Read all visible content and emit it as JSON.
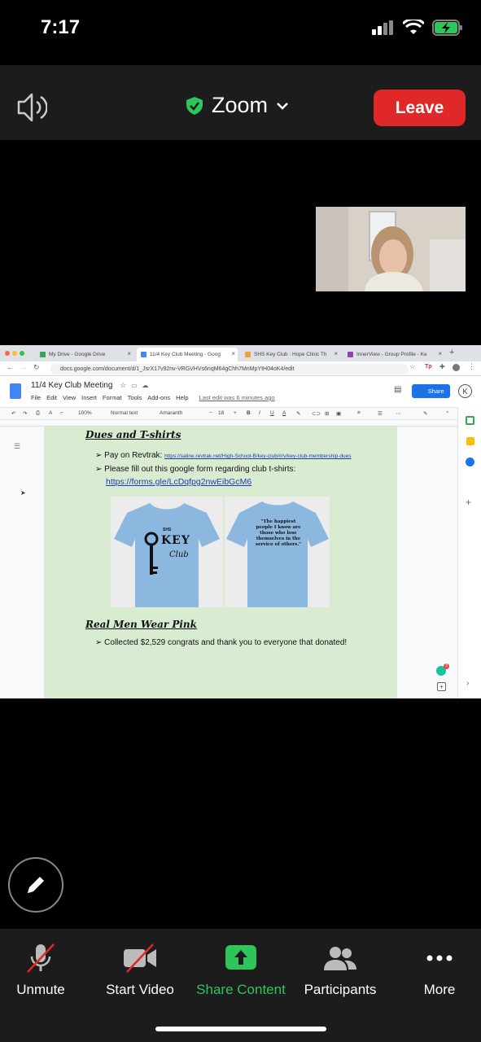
{
  "status_bar": {
    "time": "7:17"
  },
  "meeting": {
    "title": "Zoom",
    "leave_label": "Leave"
  },
  "shared_screen": {
    "tabs": [
      {
        "label": "My Drive - Google Drive",
        "favicon_color": "#34a853"
      },
      {
        "label": "11/4 Key Club Meeting - Goog",
        "favicon_color": "#4285f4"
      },
      {
        "label": "SHS Key Club : Hope Clinic Th",
        "favicon_color": "#e8a33d"
      },
      {
        "label": "InnerView - Group Profile - Ke",
        "favicon_color": "#8e44ad"
      }
    ],
    "url": "docs.google.com/document/d/1_JsrX17v92nv-VRGVHVs6nqM64gChh7MnMpYtH04oK4/edit",
    "doc_title": "11/4 Key Club Meeting",
    "menus": [
      "File",
      "Edit",
      "View",
      "Insert",
      "Format",
      "Tools",
      "Add-ons",
      "Help"
    ],
    "last_edit": "Last edit was 6 minutes ago",
    "share_label": "Share",
    "account_initial": "K",
    "toolbar": {
      "zoom": "100%",
      "style": "Normal text",
      "font": "Amaranth",
      "size": "18"
    },
    "content": {
      "heading_dues": "Dues and T-shirts",
      "bullet_revtrak_label": "Pay on Revtrak:",
      "bullet_revtrak_link": "https://saline.revtrak.net/High-School-B/key-club/#/v/key-club-membership-dues",
      "bullet_form": "Please fill out this google form regarding club t-shirts:",
      "form_link": "https://forms.gle/LcDqfpg2nwEibGcM6",
      "shirt_front_small": "SHS",
      "shirt_front_big": "KEY",
      "shirt_front_script": "Club",
      "shirt_back_quote": "\"The happiest people I know are those who lose themselves in the service of others.\"",
      "heading_pink": "Real Men Wear Pink",
      "bullet_collected": "Collected $2,529 congrats and thank you to everyone that donated!",
      "bullet_glyph": "➢",
      "grammarly_count": "3"
    }
  },
  "controls": {
    "unmute": "Unmute",
    "start_video": "Start Video",
    "share_content": "Share Content",
    "participants": "Participants",
    "more": "More"
  },
  "colors": {
    "leave": "#e02828",
    "share_green": "#2ec55b",
    "shield": "#2ec55b",
    "shirt_blue": "#8cb8e0"
  }
}
